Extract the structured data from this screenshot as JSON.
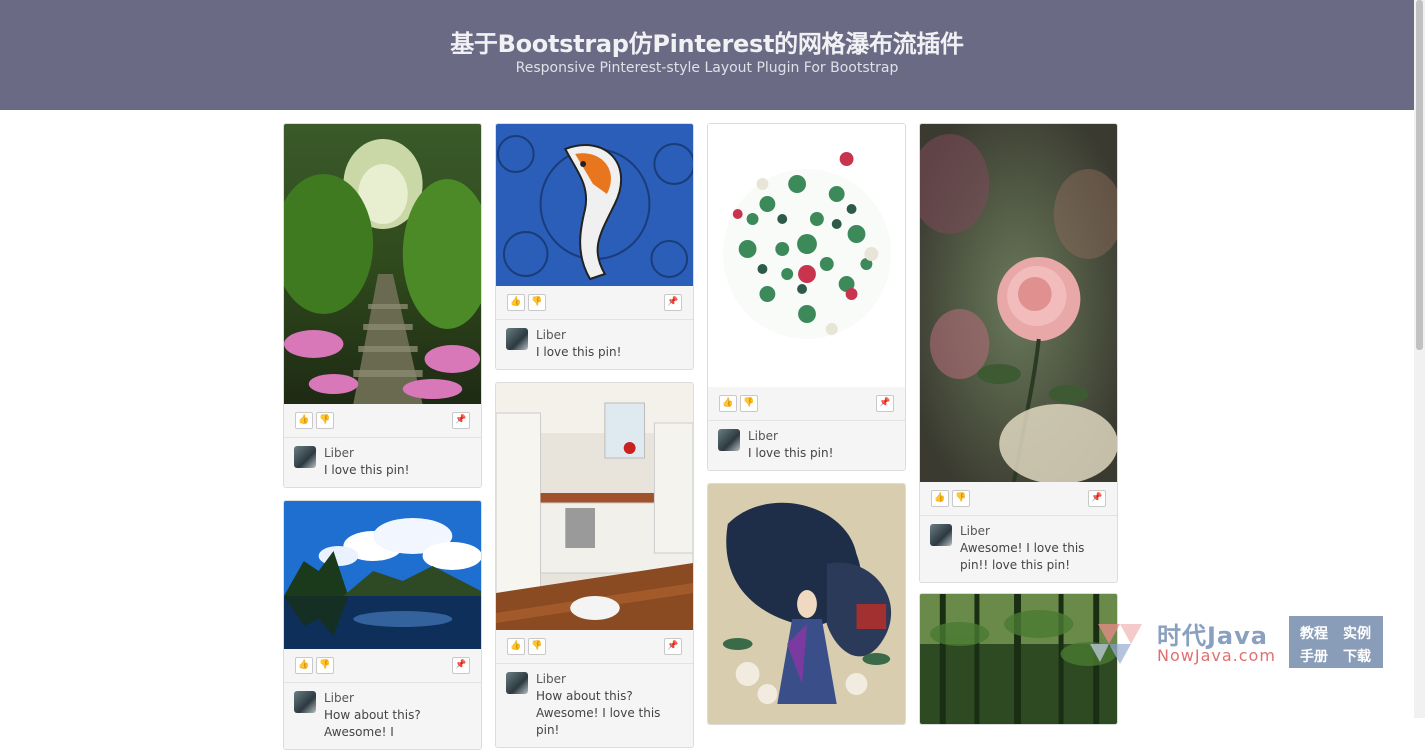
{
  "header": {
    "title": "基于Bootstrap仿Pinterest的网格瀑布流插件",
    "subtitle": "Responsive Pinterest-style Layout Plugin For Bootstrap"
  },
  "pins": [
    {
      "image": "forest-stairs",
      "author": "Liber",
      "comment": "I love this pin!"
    },
    {
      "image": "mountains-lake",
      "author": "Liber",
      "comment": "How about this? Awesome! I"
    },
    {
      "image": "koi-fish",
      "author": "Liber",
      "comment": "I love this pin!"
    },
    {
      "image": "kitchen",
      "author": "Liber",
      "comment": "How about this? Awesome! I love this pin!"
    },
    {
      "image": "flower-wreath",
      "author": "Liber",
      "comment": "I love this pin!"
    },
    {
      "image": "painted-figure",
      "author": "",
      "comment": ""
    },
    {
      "image": "pink-rose",
      "author": "Liber",
      "comment": "Awesome! I love this pin!! love this pin!"
    },
    {
      "image": "bamboo-forest",
      "author": "",
      "comment": ""
    }
  ],
  "icons": {
    "like": "thumbs-up-icon",
    "dislike": "thumbs-down-icon",
    "pin": "pin-icon"
  },
  "watermark": {
    "brand_cn": "时代Java",
    "brand_url": "NowJava.com",
    "links": [
      "教程",
      "实例",
      "手册",
      "下载"
    ]
  },
  "colors": {
    "header_bg": "#6a6a84",
    "card_bg": "#f5f5f5"
  }
}
